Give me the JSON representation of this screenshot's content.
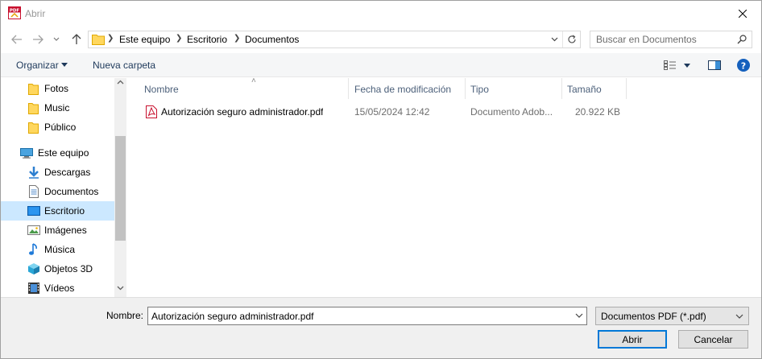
{
  "window": {
    "title": "Abrir"
  },
  "address": {
    "crumbs": [
      "Este equipo",
      "Escritorio",
      "Documentos"
    ]
  },
  "search": {
    "placeholder": "Buscar en Documentos"
  },
  "toolbar": {
    "organize_label": "Organizar",
    "new_folder_label": "Nueva carpeta"
  },
  "sidebar": {
    "items": [
      {
        "label": "Fotos",
        "icon": "folder-icon"
      },
      {
        "label": "Music",
        "icon": "folder-icon"
      },
      {
        "label": "Público",
        "icon": "folder-icon"
      },
      {
        "label": "Este equipo",
        "icon": "computer-icon"
      },
      {
        "label": "Descargas",
        "icon": "download-icon"
      },
      {
        "label": "Documentos",
        "icon": "documents-icon"
      },
      {
        "label": "Escritorio",
        "icon": "desktop-icon",
        "selected": true
      },
      {
        "label": "Imágenes",
        "icon": "pictures-icon"
      },
      {
        "label": "Música",
        "icon": "music-note-icon"
      },
      {
        "label": "Objetos 3D",
        "icon": "cube-3d-icon"
      },
      {
        "label": "Vídeos",
        "icon": "film-icon"
      }
    ]
  },
  "columns": {
    "name": "Nombre",
    "modified": "Fecha de modificación",
    "type": "Tipo",
    "size": "Tamaño"
  },
  "files": [
    {
      "name": "Autorización seguro administrador.pdf",
      "modified": "15/05/2024 12:42",
      "type": "Documento Adob...",
      "size": "20.922 KB",
      "icon": "pdf-file-icon"
    }
  ],
  "footer": {
    "filename_label": "Nombre:",
    "filename_value": "Autorización seguro administrador.pdf",
    "filter_value": "Documentos PDF (*.pdf)",
    "open_label": "Abrir",
    "cancel_label": "Cancelar"
  },
  "colors": {
    "accent": "#0078d7",
    "selection": "#cce8ff",
    "header_text": "#4c607a",
    "muted_text": "#6d6d6d",
    "help_blue": "#1560bd"
  }
}
